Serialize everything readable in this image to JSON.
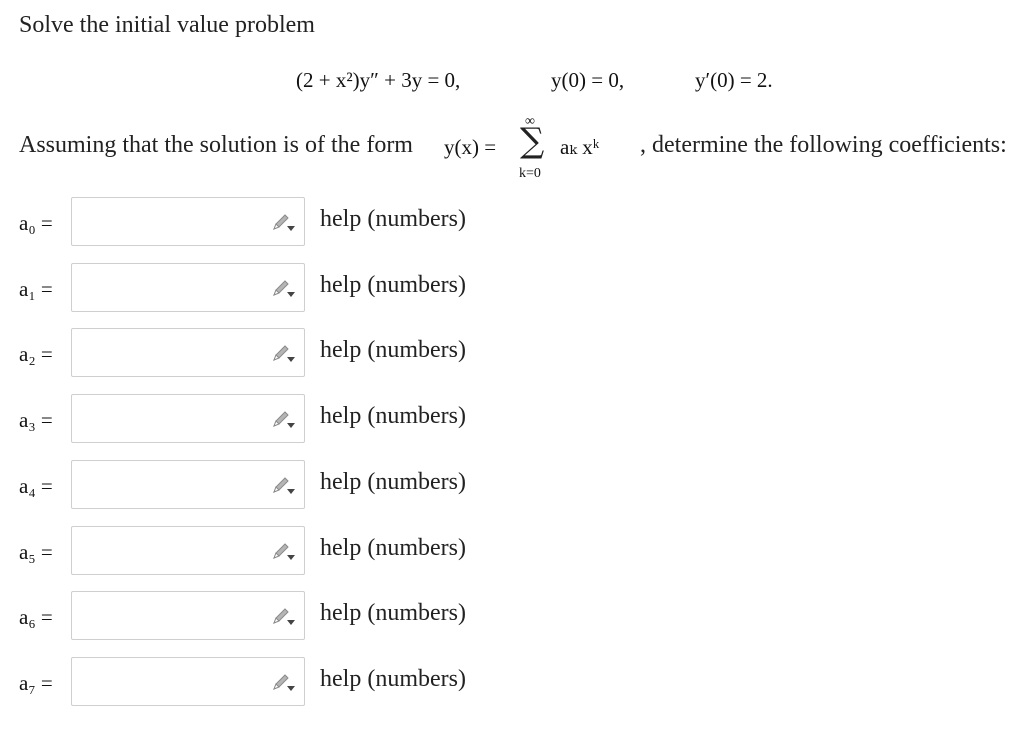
{
  "problem": {
    "intro": "Solve the initial value problem",
    "equation": {
      "ode": "(2 + x²)y″ + 3y = 0,",
      "condition_1": "y(0) = 0,",
      "condition_2": "y′(0) = 2."
    },
    "assumption": {
      "prefix": "Assuming that the solution is of the form",
      "lhs": "y(x) =",
      "sum_symbol": "∑",
      "sum_upper": "∞",
      "sum_lower": "k=0",
      "summand": "aₖ xᵏ",
      "suffix": ", determine the following coefficients:"
    }
  },
  "coefficients": [
    {
      "label": "a₀ =",
      "value": "",
      "help": "help (numbers)"
    },
    {
      "label": "a₁ =",
      "value": "",
      "help": "help (numbers)"
    },
    {
      "label": "a₂ =",
      "value": "",
      "help": "help (numbers)"
    },
    {
      "label": "a₃ =",
      "value": "",
      "help": "help (numbers)"
    },
    {
      "label": "a₄ =",
      "value": "",
      "help": "help (numbers)"
    },
    {
      "label": "a₅ =",
      "value": "",
      "help": "help (numbers)"
    },
    {
      "label": "a₆ =",
      "value": "",
      "help": "help (numbers)"
    },
    {
      "label": "a₇ =",
      "value": "",
      "help": "help (numbers)"
    }
  ],
  "icons": {
    "equation_editor": "pencil-icon",
    "pencil_color": "#9a9a9a",
    "arrow_color": "#444444"
  }
}
